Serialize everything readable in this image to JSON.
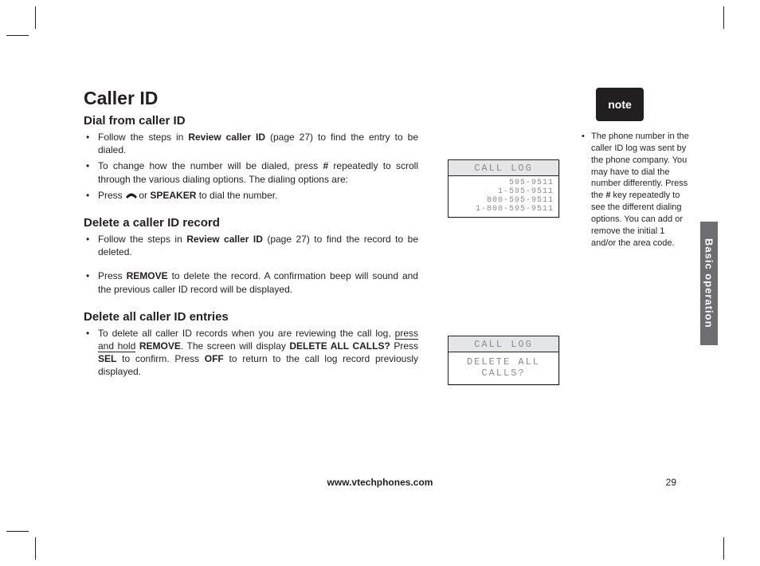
{
  "title": "Caller ID",
  "sections": {
    "dial": {
      "heading": "Dial from caller ID",
      "items": [
        {
          "pre": "Follow the steps in ",
          "bold1": "Review caller ID",
          "post1": " (page 27) to find the entry to be dialed."
        },
        {
          "pre": "To change how the number will be dialed, press ",
          "bold1": "#",
          "post1": " repeatedly to scroll through the various dialing options. The dialing options are:"
        },
        {
          "pre": "Press ",
          "icon": true,
          "mid": " or ",
          "bold1": "SPEAKER",
          "post1": " to dial the number."
        }
      ]
    },
    "del_one": {
      "heading": "Delete a caller ID record",
      "items": [
        {
          "pre": "Follow the steps in ",
          "bold1": "Review caller ID",
          "post1": " (page 27) to find the record to be deleted."
        },
        {
          "pre": "Press ",
          "bold1": "REMOVE",
          "post1": " to delete the record. A confirmation beep will sound and the previous caller ID record will be displayed."
        }
      ]
    },
    "del_all": {
      "heading": "Delete all caller ID entries",
      "item": {
        "p1": "To delete all caller ID records when you are reviewing the call log, ",
        "hold": "press and hold",
        "sp": " ",
        "b1": "REMOVE",
        "p2": ". The screen will display ",
        "b2": "DELETE ALL CALLS?",
        "p3": " Press ",
        "b3": "SEL",
        "p4": " to confirm. Press ",
        "b4": "OFF",
        "p5": " to return to the call log record previously displayed."
      }
    }
  },
  "lcd1": {
    "title": "CALL LOG",
    "lines": "595-9511\n1-595-9511\n800-595-9511\n1-800-595-9511"
  },
  "lcd2": {
    "title": "CALL LOG",
    "body": "DELETE ALL\nCALLS?"
  },
  "note": {
    "badge": "note",
    "text_p1": "The phone number in the caller ID log was sent by the phone company. You may have to dial the number differently. Press the ",
    "hash": "#",
    "text_p2": " key repeatedly to see the different dialing options. You can add or remove the initial 1 and/or the area code."
  },
  "sidetab": "Basic operation",
  "footer_url": "www.vtechphones.com",
  "page_number": "29"
}
